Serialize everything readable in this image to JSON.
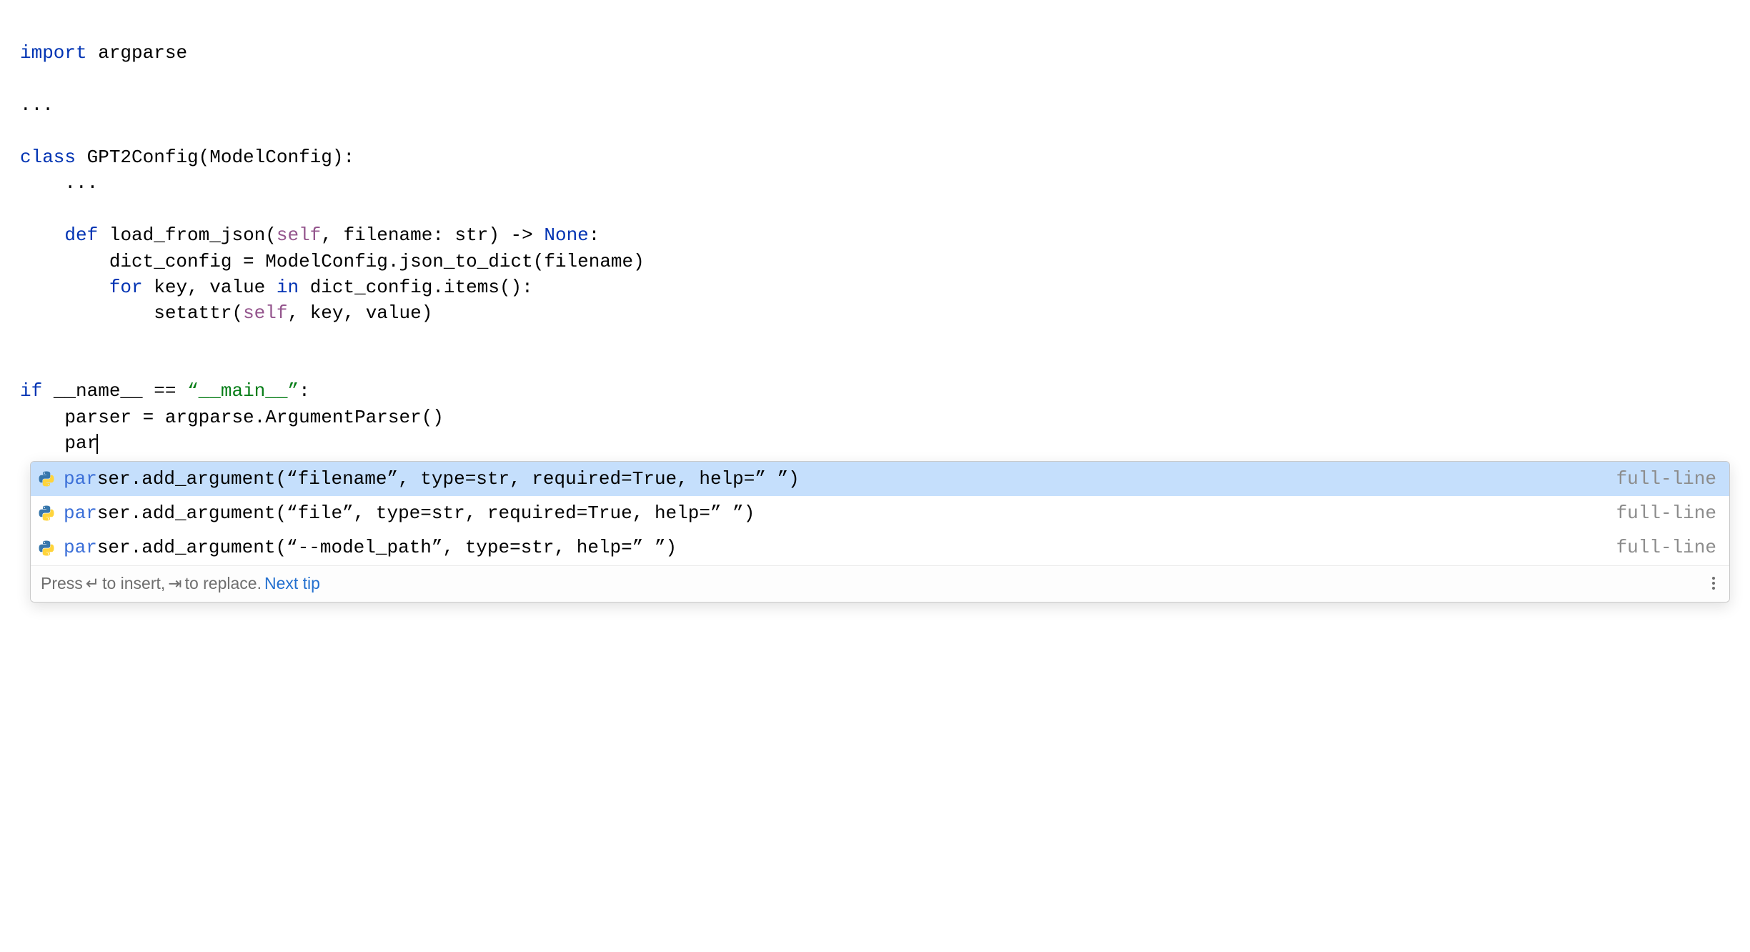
{
  "code": {
    "l1_kw": "import",
    "l1_rest": " argparse",
    "l3": "...",
    "l5_kw": "class",
    "l5_rest": " GPT2Config(ModelConfig):",
    "l6": "    ...",
    "l8_indent": "    ",
    "l8_kw": "def",
    "l8_a": " load_from_json(",
    "l8_self": "self",
    "l8_b": ", filename: str) -> ",
    "l8_none": "None",
    "l8_c": ":",
    "l9": "        dict_config = ModelConfig.json_to_dict(filename)",
    "l10_indent": "        ",
    "l10_for": "for",
    "l10_a": " key, value ",
    "l10_in": "in",
    "l10_b": " dict_config.items():",
    "l11_a": "            setattr(",
    "l11_self": "self",
    "l11_b": ", key, value)",
    "l14_kw": "if",
    "l14_a": " __name__ == ",
    "l14_str": "“__main__”",
    "l14_b": ":",
    "l15": "    parser = argparse.ArgumentParser()",
    "l16": "    par"
  },
  "completions": [
    {
      "match": "par",
      "rest": "ser.add_argument(“filename”, type=str, required=True, help=” ”)",
      "tag": "full-line",
      "selected": true
    },
    {
      "match": "par",
      "rest": "ser.add_argument(“file”, type=str, required=True, help=” ”)",
      "tag": "full-line",
      "selected": false
    },
    {
      "match": "par",
      "rest": "ser.add_argument(“--model_path”, type=str, help=” ”)",
      "tag": "full-line",
      "selected": false
    }
  ],
  "footer": {
    "press": "Press ",
    "enter_glyph": "↵",
    "to_insert": " to insert, ",
    "tab_glyph": "⇥",
    "to_replace": " to replace. ",
    "next_tip": "Next tip"
  }
}
